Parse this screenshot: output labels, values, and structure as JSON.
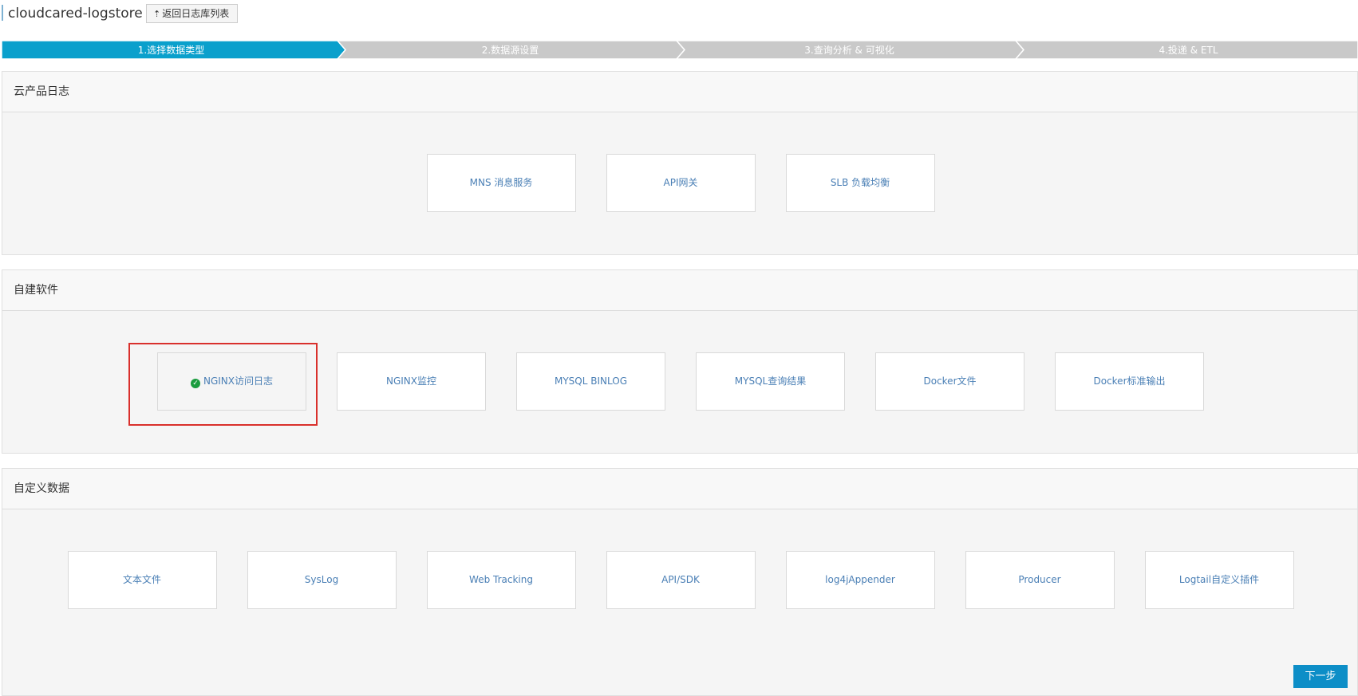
{
  "header": {
    "title": "cloudcared-logstore",
    "back_label": "返回日志库列表",
    "back_icon": "upload-arrow-icon"
  },
  "steps": [
    {
      "label": "1.选择数据类型",
      "active": true
    },
    {
      "label": "2.数据源设置",
      "active": false
    },
    {
      "label": "3.查询分析 & 可视化",
      "active": false
    },
    {
      "label": "4.投递 & ETL",
      "active": false
    }
  ],
  "colors": {
    "active_step": "#0aa0cc",
    "inactive_step": "#c9c9c9",
    "card_text": "#4a7fb5",
    "highlight": "#d9302c",
    "check": "#1a9c3e",
    "primary_button": "#0d8ec7"
  },
  "sections": [
    {
      "title": "云产品日志",
      "cards": [
        "MNS 消息服务",
        "API网关",
        "SLB 负载均衡"
      ]
    },
    {
      "title": "自建软件",
      "cards": [
        "NGINX访问日志",
        "NGINX监控",
        "MYSQL BINLOG",
        "MYSQL查询结果",
        "Docker文件",
        "Docker标准输出"
      ],
      "selected": "NGINX访问日志"
    },
    {
      "title": "自定义数据",
      "cards": [
        "文本文件",
        "SysLog",
        "Web Tracking",
        "API/SDK",
        "log4jAppender",
        "Producer",
        "Logtail自定义插件"
      ]
    }
  ],
  "footer": {
    "next_label": "下一步"
  }
}
